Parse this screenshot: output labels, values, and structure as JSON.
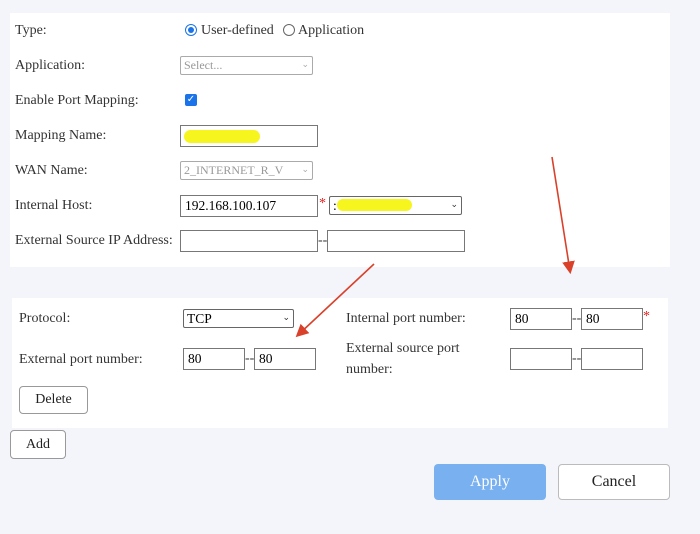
{
  "form": {
    "type_label": "Type:",
    "type_option_user": "User-defined",
    "type_option_app": "Application",
    "type_selected": "User-defined",
    "application_label": "Application:",
    "application_placeholder": "Select...",
    "enable_port_mapping_label": "Enable Port Mapping:",
    "enable_port_mapping_checked": true,
    "mapping_name_label": "Mapping Name:",
    "mapping_name_value": "",
    "wan_name_label": "WAN Name:",
    "wan_name_value": "2_INTERNET_R_V",
    "internal_host_label": "Internal Host:",
    "internal_host_value": "192.168.100.107",
    "internal_host_select_prefix": ":",
    "external_source_ip_label": "External Source IP Address:",
    "external_source_ip_start": "",
    "external_source_ip_end": "",
    "range_separator": "--",
    "required_mark": "*"
  },
  "rule": {
    "protocol_label": "Protocol:",
    "protocol_value": "TCP",
    "internal_port_label": "Internal port number:",
    "internal_port_start": "80",
    "internal_port_end": "80",
    "external_port_label": "External port number:",
    "external_port_start": "80",
    "external_port_end": "80",
    "external_source_port_label_line1": "External source port",
    "external_source_port_label_line2": "number:",
    "external_source_port_start": "",
    "external_source_port_end": "",
    "delete_label": "Delete"
  },
  "actions": {
    "add_label": "Add",
    "apply_label": "Apply",
    "cancel_label": "Cancel"
  },
  "colors": {
    "page_bg": "#f4f5fb",
    "accent": "#1a73e8",
    "apply_bg": "#79b0f0",
    "required": "#e02020",
    "annotation_arrow": "#d9412b",
    "redaction": "#f7f51e"
  }
}
